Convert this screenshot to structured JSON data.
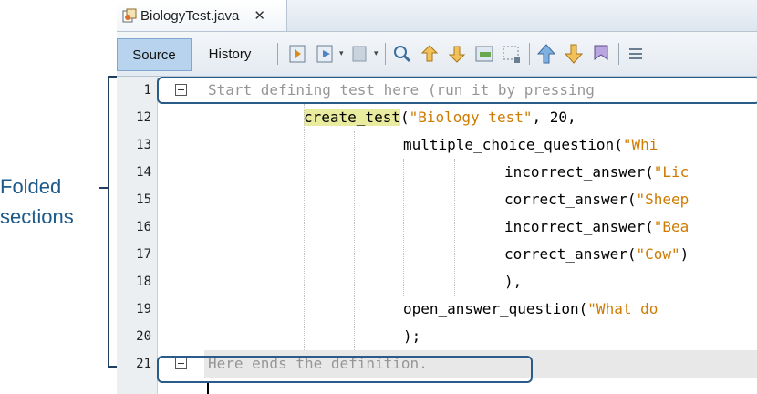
{
  "tab": {
    "file_name": "BiologyTest.java",
    "close_glyph": "✕",
    "icon": "java-file-icon"
  },
  "toolbar": {
    "source_label": "Source",
    "history_label": "History",
    "icons": [
      "back-icon",
      "forward-icon",
      "history-dropdown-icon",
      "find-icon",
      "find-previous-icon",
      "find-next-icon",
      "toggle-highlight-icon",
      "toggle-rectangular-selection-icon",
      "previous-bookmark-icon",
      "next-bookmark-icon",
      "toggle-bookmark-icon",
      "shift-left-icon"
    ]
  },
  "editor": {
    "line_numbers": [
      "1",
      "12",
      "13",
      "14",
      "15",
      "16",
      "17",
      "18",
      "19",
      "20",
      "21"
    ],
    "lines": [
      {
        "parts": [
          "Start defining test here (run it by pressing"
        ]
      },
      {
        "parts": [
          "create_test",
          "(",
          "\"Biology test\"",
          ", 20,"
        ]
      },
      {
        "parts": [
          "multiple_choice_question(",
          "\"Whi"
        ]
      },
      {
        "parts": [
          "incorrect_answer(",
          "\"Lic"
        ]
      },
      {
        "parts": [
          "correct_answer(",
          "\"Sheep"
        ]
      },
      {
        "parts": [
          "incorrect_answer(",
          "\"Bea"
        ]
      },
      {
        "parts": [
          "correct_answer(",
          "\"Cow\"",
          ")"
        ]
      },
      {
        "parts": [
          "),"
        ]
      },
      {
        "parts": [
          "open_answer_question(",
          "\"What do"
        ]
      },
      {
        "parts": [
          ");"
        ]
      },
      {
        "parts": [
          "Here ends the definition."
        ]
      }
    ]
  },
  "annotation": {
    "line1": "Folded",
    "line2": "sections"
  },
  "colors": {
    "accent": "#2a5c89",
    "string": "#ce7b00",
    "comment": "#969696",
    "highlight": "#e9ec9f"
  }
}
